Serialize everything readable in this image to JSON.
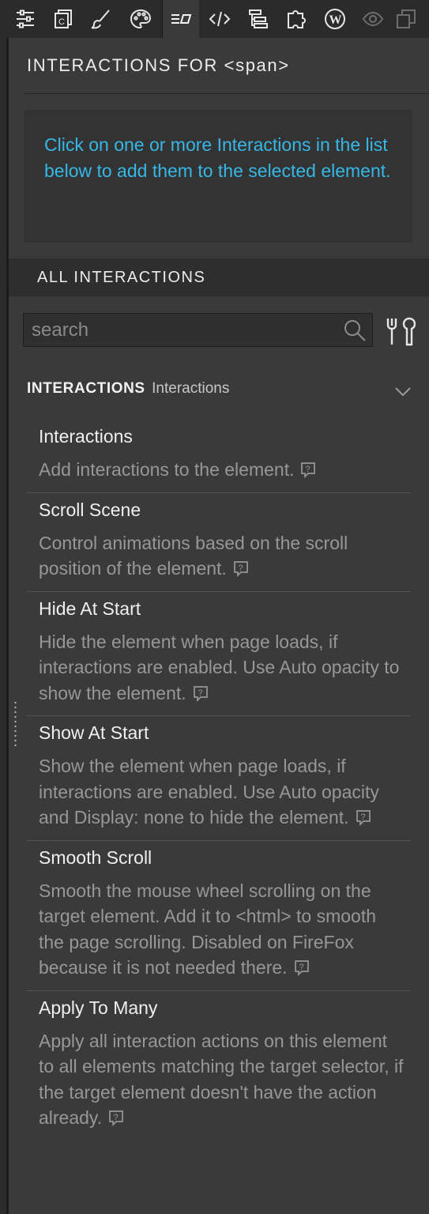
{
  "toolbar": {
    "icons": [
      "sliders-icon",
      "document-icon",
      "brush-icon",
      "palette-icon",
      "interactions-icon",
      "code-icon",
      "tree-icon",
      "puzzle-icon",
      "wordpress-icon",
      "eye-icon",
      "layers-icon"
    ],
    "active": "interactions-icon"
  },
  "panel": {
    "title": "INTERACTIONS FOR  <span>",
    "info_text": "Click on one or more Interactions in the list below to add them to the selected element.",
    "info_color": "#36b7e6"
  },
  "section": {
    "title": "ALL INTERACTIONS"
  },
  "search": {
    "placeholder": "search",
    "value": ""
  },
  "group": {
    "title": "INTERACTIONS",
    "subtitle": "Interactions",
    "expanded": true,
    "items": [
      {
        "title": "Interactions",
        "description": "Add interactions to the element."
      },
      {
        "title": "Scroll Scene",
        "description": "Control animations based on the scroll position of the element."
      },
      {
        "title": "Hide At Start",
        "description": "Hide the element when page loads, if interactions are enabled. Use Auto opacity to show the element."
      },
      {
        "title": "Show At Start",
        "description": "Show the element when page loads, if interactions are enabled. Use Auto opacity and Display: none to hide the element."
      },
      {
        "title": "Smooth Scroll",
        "description": "Smooth the mouse wheel scrolling on the target element. Add it to <html> to smooth the page scrolling. Disabled on FireFox because it is not needed there."
      },
      {
        "title": "Apply To Many",
        "description": "Apply all interaction actions on this element to all elements matching the target selector, if the target element doesn't have the action already."
      }
    ]
  }
}
